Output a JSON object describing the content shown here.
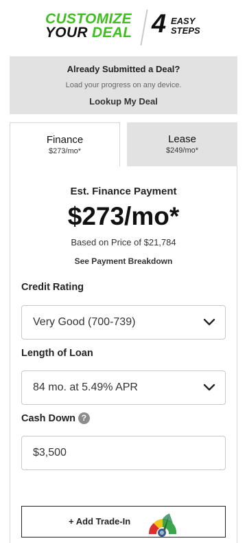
{
  "header": {
    "brand_line1": "CUSTOMIZE",
    "brand_line2_a": "YOUR ",
    "brand_line2_b": "DEAL",
    "steps_number": "4",
    "steps_line1": "EASY",
    "steps_line2": "STEPS"
  },
  "submitted": {
    "title": "Already Submitted a Deal?",
    "subtitle": "Load your progress on any device.",
    "link": "Lookup My Deal"
  },
  "tabs": [
    {
      "label": "Finance",
      "price": "$273/mo*",
      "active": true
    },
    {
      "label": "Lease",
      "price": "$249/mo*",
      "active": false
    }
  ],
  "estimate": {
    "title": "Est. Finance Payment",
    "amount": "$273/mo*",
    "based_on": "Based on Price of $21,784",
    "breakdown_link": "See Payment Breakdown"
  },
  "credit": {
    "label": "Credit Rating",
    "value": "Very Good (700-739)"
  },
  "loan": {
    "label": "Length of Loan",
    "value": "84 mo. at 5.49% APR"
  },
  "cash": {
    "label": "Cash Down",
    "help": "?",
    "value": "$3,500"
  },
  "trade": {
    "label": "+ Add Trade-In"
  },
  "colors": {
    "accent_green": "#3fbf1f",
    "panel_gray": "#e2e2e2"
  },
  "icons": [
    "chevron-down-icon",
    "help-icon",
    "trade-gauge-icon"
  ]
}
